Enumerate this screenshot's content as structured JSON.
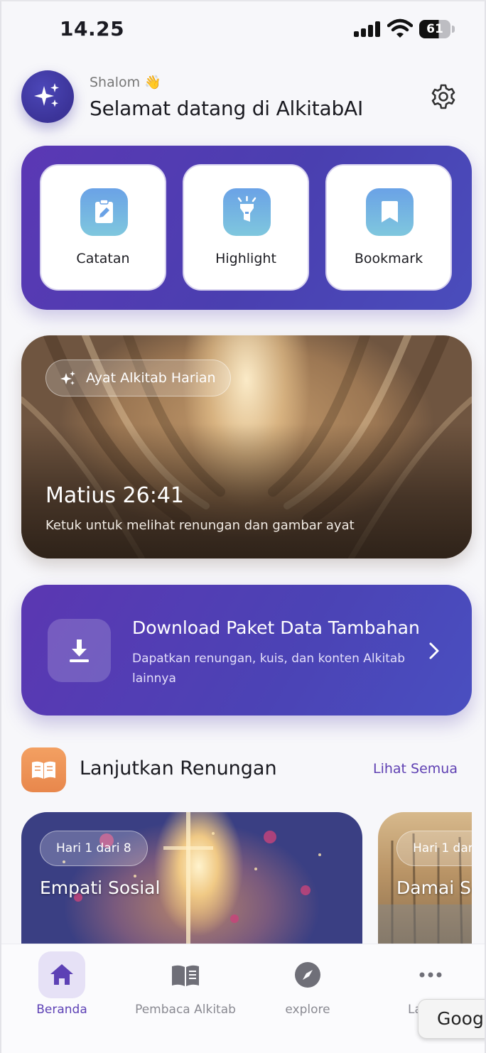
{
  "status_bar": {
    "time": "14.25",
    "battery": "61"
  },
  "header": {
    "greeting": "Shalom 👋",
    "title": "Selamat datang di AlkitabAI"
  },
  "quick_actions": [
    {
      "label": "Catatan",
      "icon": "clipboard-edit-icon"
    },
    {
      "label": "Highlight",
      "icon": "highlighter-icon"
    },
    {
      "label": "Bookmark",
      "icon": "bookmark-icon"
    }
  ],
  "daily_verse": {
    "badge": "Ayat Alkitab Harian",
    "reference": "Matius 26:41",
    "hint": "Ketuk untuk melihat renungan dan gambar ayat"
  },
  "download_banner": {
    "title": "Download Paket Data Tambahan",
    "description": "Dapatkan renungan, kuis, dan konten Alkitab lainnya"
  },
  "devotions": {
    "title": "Lanjutkan Renungan",
    "see_all": "Lihat Semua",
    "items": [
      {
        "day": "Hari 1 dari 8",
        "title": "Empati Sosial"
      },
      {
        "day": "Hari 1 dar",
        "title": "Damai Se"
      }
    ]
  },
  "bottom_nav": {
    "items": [
      {
        "label": "Beranda",
        "icon": "home-icon",
        "active": true
      },
      {
        "label": "Pembaca Alkitab",
        "icon": "book-icon",
        "active": false
      },
      {
        "label": "explore",
        "icon": "compass-icon",
        "active": false
      },
      {
        "label": "La",
        "icon": "more-icon",
        "active": false
      }
    ]
  },
  "overlay": {
    "google_tab": "Goog"
  },
  "colors": {
    "primary": "#4a3fb0",
    "accent_text": "#5e3fb2",
    "orange": "#ec8d52",
    "icon_blue": "#6aa2e6"
  }
}
